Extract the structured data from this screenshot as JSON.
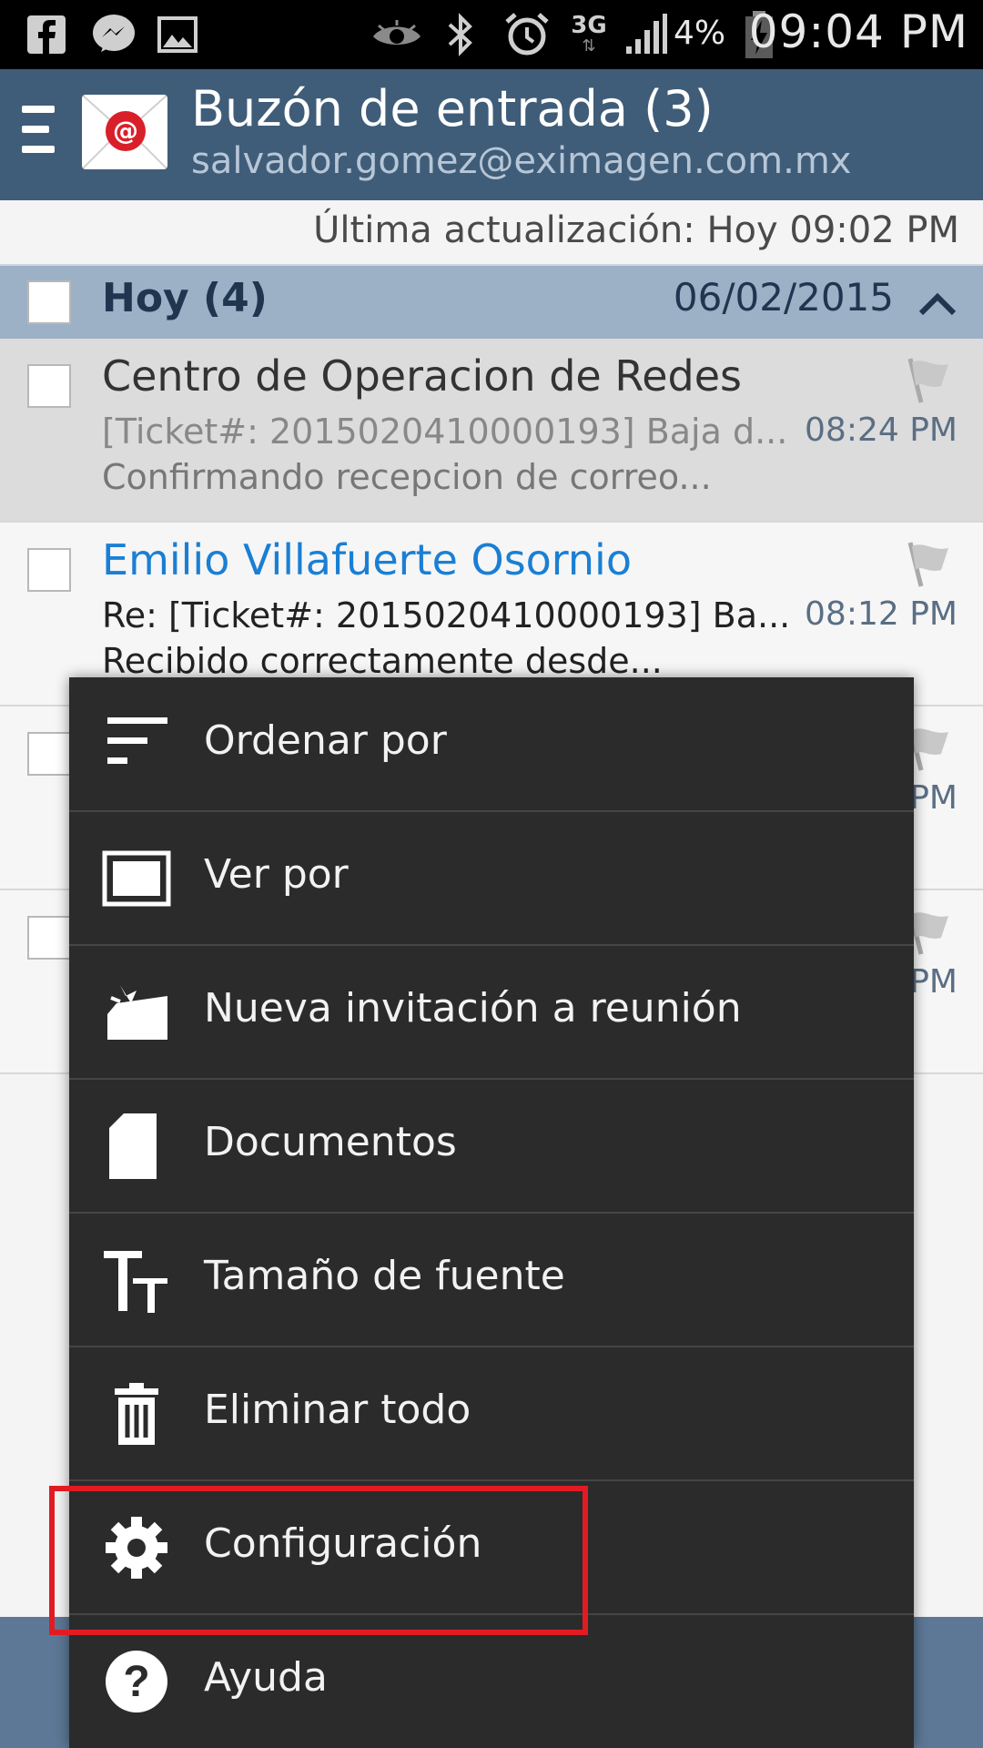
{
  "status_bar": {
    "time": "09:04 PM",
    "battery_percent": "4%",
    "network": "3G",
    "icons": [
      "facebook-icon",
      "messenger-icon",
      "image-icon",
      "eye-icon",
      "bluetooth-icon",
      "alarm-icon",
      "network-3g-icon",
      "signal-icon",
      "battery-charging-icon"
    ]
  },
  "header": {
    "title": "Buzón de entrada (3)",
    "account": "salvador.gomez@eximagen.com.mx",
    "logo_glyph": "@",
    "bar_color": "#3f5d79"
  },
  "last_update": "Última actualización: Hoy 09:02 PM",
  "group": {
    "title": "Hoy (4)",
    "date": "06/02/2015",
    "expanded": true
  },
  "mails": [
    {
      "sender": "Centro de Operacion de Redes",
      "subject": "[Ticket#: 2015020410000193] Baja d...",
      "preview": "Confirmando recepcion de correo...",
      "time": "08:24 PM",
      "read": true
    },
    {
      "sender": "Emilio Villafuerte Osornio",
      "subject": "Re: [Ticket#: 2015020410000193] Ba...",
      "preview": "Recibido correctamente desde...",
      "time": "08:12 PM",
      "read": false
    },
    {
      "time_partial": "PM"
    },
    {
      "time_partial": "PM"
    }
  ],
  "menu": {
    "items": [
      {
        "label": "Ordenar por",
        "icon": "sort-icon"
      },
      {
        "label": "Ver por",
        "icon": "view-icon"
      },
      {
        "label": "Nueva invitación a reunión",
        "icon": "meeting-invite-icon"
      },
      {
        "label": "Documentos",
        "icon": "document-icon"
      },
      {
        "label": "Tamaño de fuente",
        "icon": "font-size-icon"
      },
      {
        "label": "Eliminar todo",
        "icon": "trash-icon"
      },
      {
        "label": "Configuración",
        "icon": "gear-icon",
        "highlighted": true
      },
      {
        "label": "Ayuda",
        "icon": "help-icon"
      }
    ]
  },
  "colors": {
    "accent_unread": "#1a7fd4",
    "highlight_box": "#e21b23",
    "menu_bg": "#2b2b2b"
  }
}
